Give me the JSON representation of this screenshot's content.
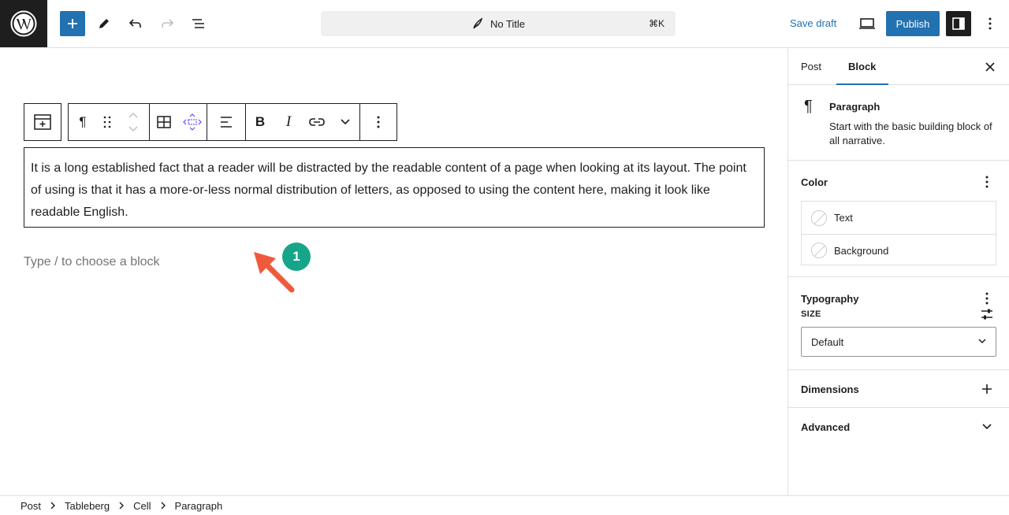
{
  "topbar": {
    "title": "No Title",
    "shortcut": "⌘K",
    "save_draft": "Save draft",
    "publish": "Publish"
  },
  "editor": {
    "paragraph_text": "It is a long established fact that a reader will be distracted by the readable content of a page when looking at its layout. The point of using is that it has a more-or-less normal distribution of letters, as opposed to using the content here, making it look like readable English.",
    "placeholder": "Type / to choose a block",
    "annotation_number": "1"
  },
  "toolbar": {
    "paragraph_glyph": "¶",
    "bold": "B",
    "italic": "I"
  },
  "sidebar": {
    "tab_post": "Post",
    "tab_block": "Block",
    "block_name": "Paragraph",
    "block_description": "Start with the basic building block of all narrative.",
    "color_title": "Color",
    "color_items": [
      "Text",
      "Background"
    ],
    "typography_title": "Typography",
    "size_label": "SIZE",
    "size_value": "Default",
    "dimensions_title": "Dimensions",
    "advanced_title": "Advanced"
  },
  "breadcrumb": [
    "Post",
    "Tableberg",
    "Cell",
    "Paragraph"
  ],
  "colors": {
    "accent": "#2271b1",
    "badge": "#17a589",
    "arrow": "#f05a3c"
  }
}
